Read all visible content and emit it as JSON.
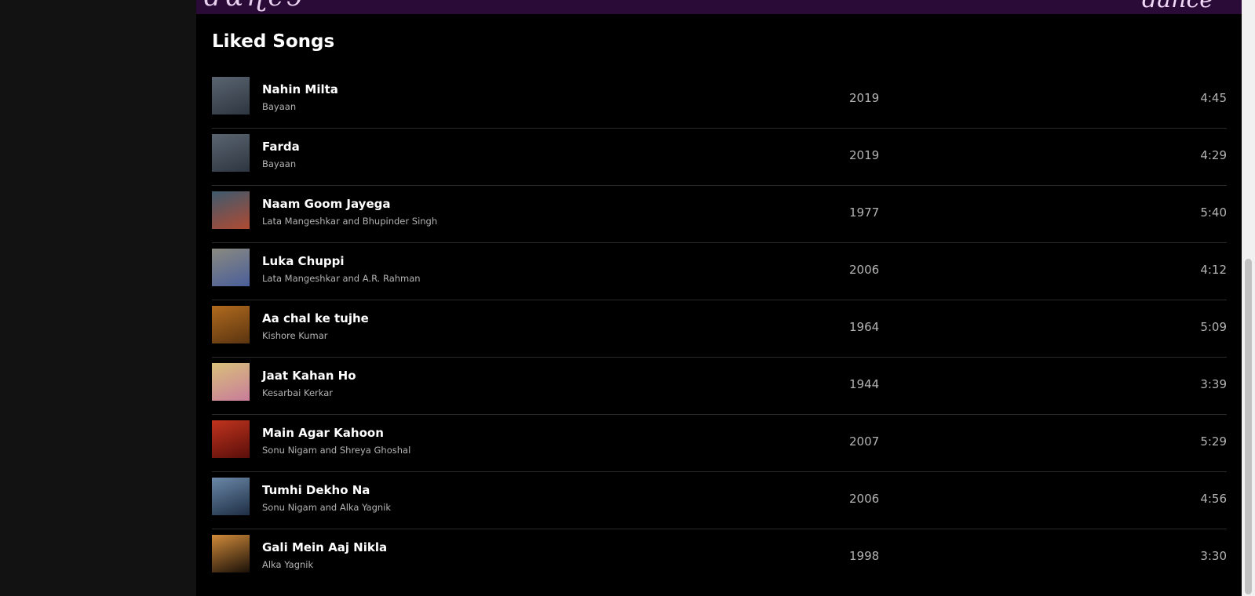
{
  "section_title": "Liked Songs",
  "banner": {
    "word": "dance"
  },
  "songs": [
    {
      "title": "Nahin Milta",
      "artist": "Bayaan",
      "year": "2019",
      "duration": "4:45",
      "cover_colors": [
        "#5a6470",
        "#2d3640"
      ]
    },
    {
      "title": "Farda",
      "artist": "Bayaan",
      "year": "2019",
      "duration": "4:29",
      "cover_colors": [
        "#5a6470",
        "#2d3640"
      ]
    },
    {
      "title": "Naam Goom Jayega",
      "artist": "Lata Mangeshkar and Bhupinder Singh",
      "year": "1977",
      "duration": "5:40",
      "cover_colors": [
        "#3d5a6e",
        "#b04a32"
      ]
    },
    {
      "title": "Luka Chuppi",
      "artist": "Lata Mangeshkar and A.R. Rahman",
      "year": "2006",
      "duration": "4:12",
      "cover_colors": [
        "#8a8a80",
        "#4a5e9a"
      ]
    },
    {
      "title": "Aa chal ke tujhe",
      "artist": "Kishore Kumar",
      "year": "1964",
      "duration": "5:09",
      "cover_colors": [
        "#b06a1e",
        "#5a3410"
      ]
    },
    {
      "title": "Jaat Kahan Ho",
      "artist": "Kesarbai Kerkar",
      "year": "1944",
      "duration": "3:39",
      "cover_colors": [
        "#d9c07a",
        "#c87c9a"
      ]
    },
    {
      "title": "Main Agar Kahoon",
      "artist": "Sonu Nigam and Shreya Ghoshal",
      "year": "2007",
      "duration": "5:29",
      "cover_colors": [
        "#c0341e",
        "#5a0e0a"
      ]
    },
    {
      "title": "Tumhi Dekho Na",
      "artist": "Sonu Nigam and Alka Yagnik",
      "year": "2006",
      "duration": "4:56",
      "cover_colors": [
        "#6a88a8",
        "#1e2e44"
      ]
    },
    {
      "title": "Gali Mein Aaj Nikla",
      "artist": "Alka Yagnik",
      "year": "1998",
      "duration": "3:30",
      "cover_colors": [
        "#d08a3a",
        "#1a1008"
      ]
    }
  ]
}
